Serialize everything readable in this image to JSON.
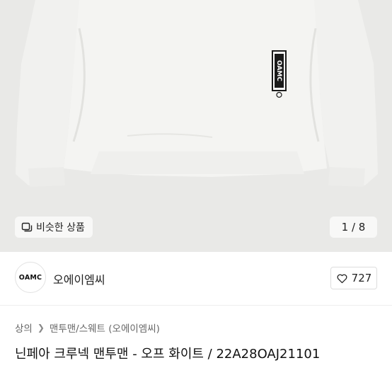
{
  "hero": {
    "similar_button_label": "비슷한 상품",
    "page_counter": "1 / 8",
    "print_logo_text": "OAMC"
  },
  "brand": {
    "logo_text": "OAMC",
    "name": "오에이엠씨",
    "like_count": "727"
  },
  "breadcrumb": {
    "items": [
      "상의",
      "맨투맨/스웨트 (오에이엠씨)"
    ]
  },
  "product": {
    "title": "닌페아 크루넥 맨투맨 - 오프 화이트 / 22A28OAJ21101"
  },
  "icons": {
    "similar": "similar-items-icon",
    "like": "heart-icon",
    "separator": "chevron-right-icon"
  },
  "colors": {
    "hero_background": "#e9e9e7",
    "garment": "#f3f3f1",
    "text": "#222222"
  }
}
